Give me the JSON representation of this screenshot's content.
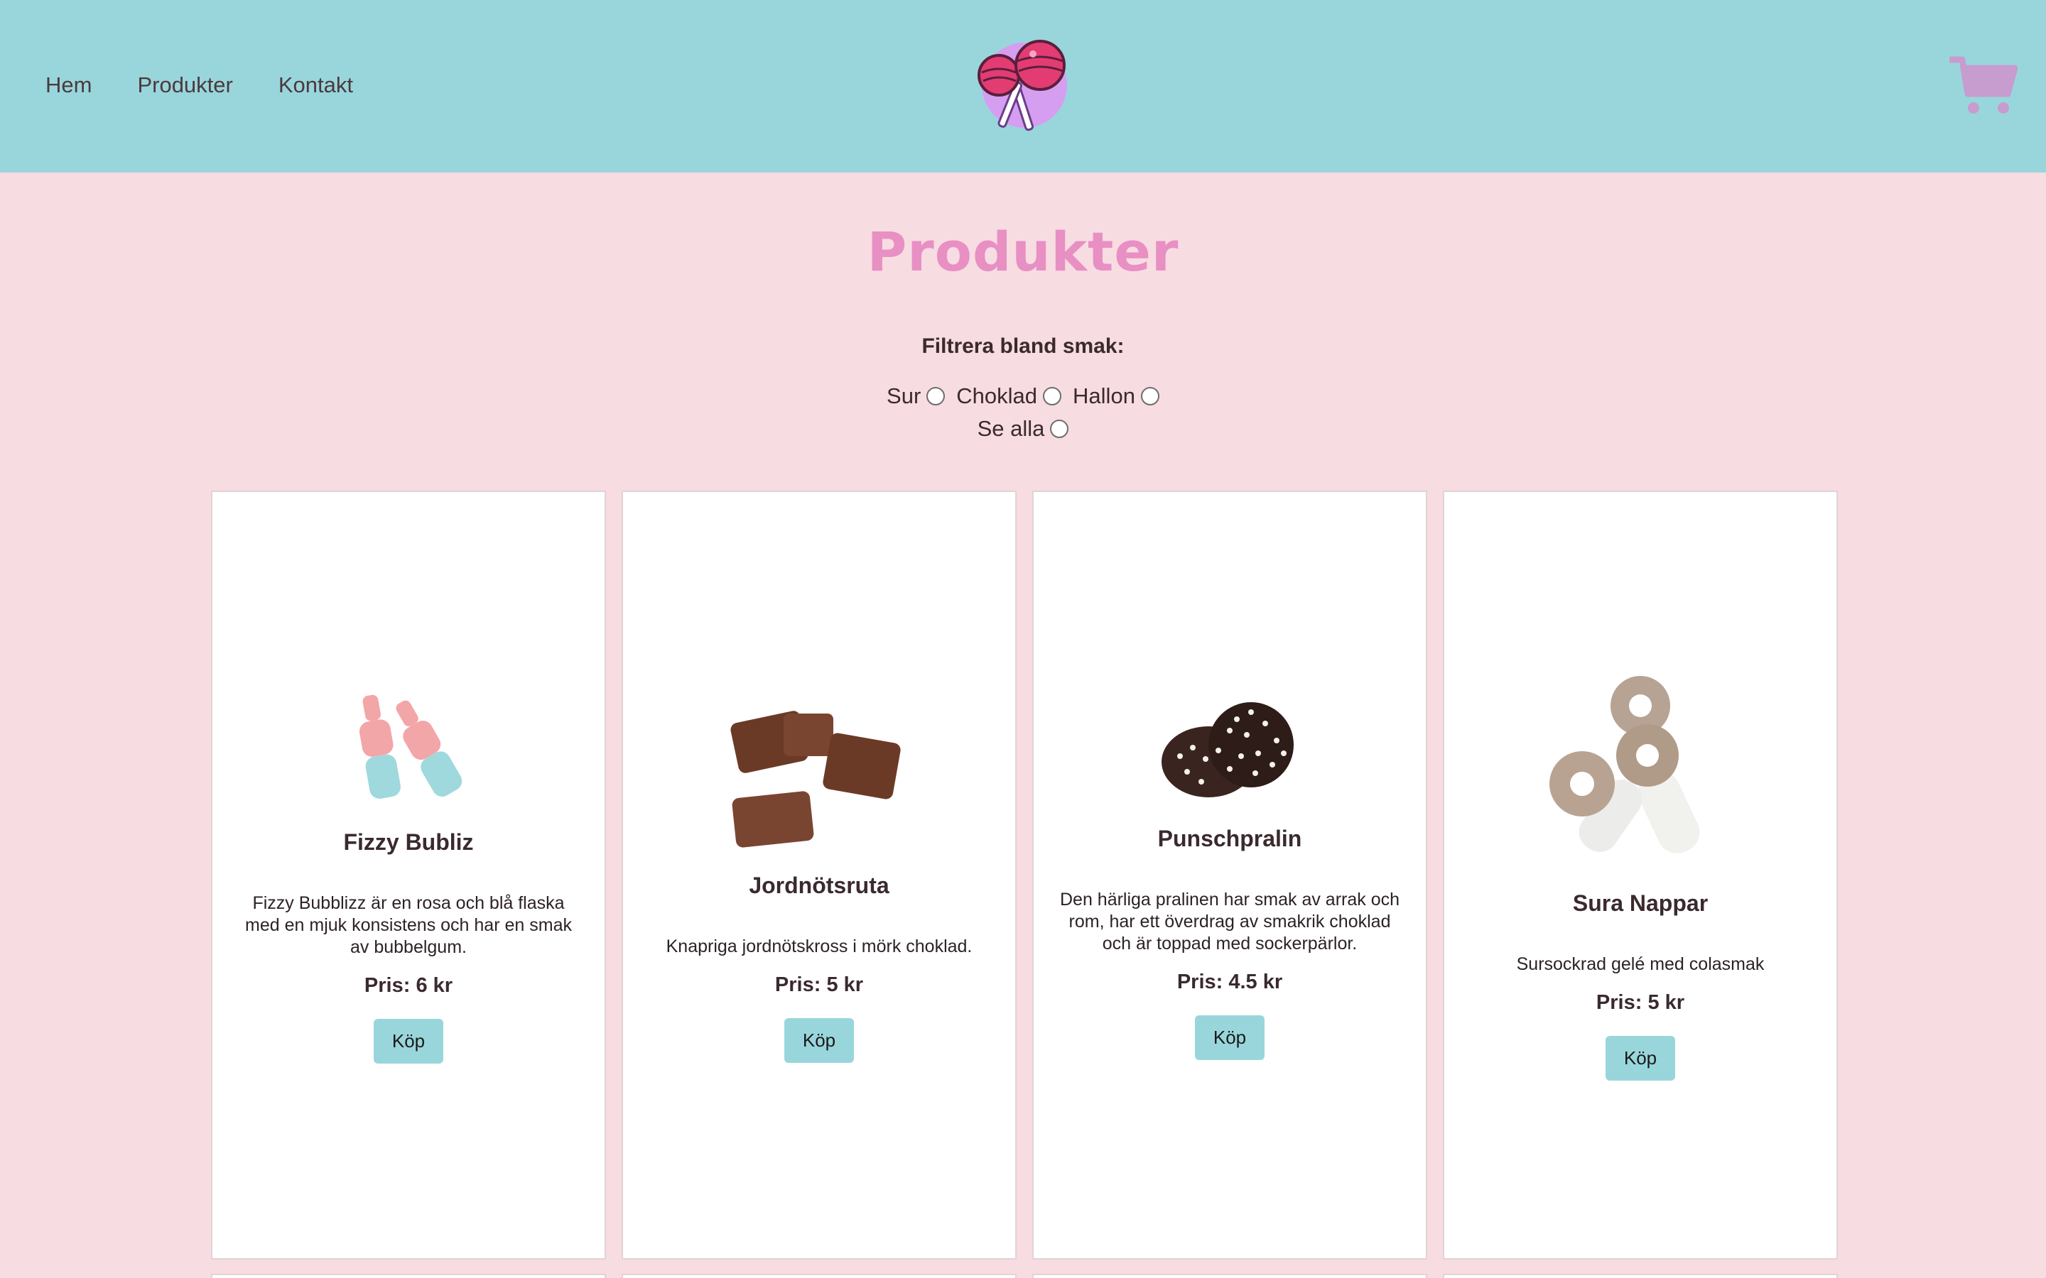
{
  "nav": {
    "items": [
      "Hem",
      "Produkter",
      "Kontakt"
    ]
  },
  "logo": {
    "icon": "lollipop-logo-icon"
  },
  "cart": {
    "icon": "shopping-cart-icon",
    "color": "#c79ccf"
  },
  "page": {
    "title": "Produkter",
    "title_color": "#e88fc4"
  },
  "filter": {
    "heading": "Filtrera bland smak:",
    "options": [
      "Sur",
      "Choklad",
      "Hallon",
      "Se alla"
    ]
  },
  "colors": {
    "header_bg": "#99d6dc",
    "page_bg": "#f7dce1",
    "button_bg": "#99d6dc"
  },
  "products": [
    {
      "name": "Fizzy Bubliz",
      "description": "Fizzy Bubblizz är en rosa och blå flaska med en mjuk konsistens och har en smak av bubbelgum.",
      "price": "Pris: 6 kr",
      "button": "Köp",
      "image": "fizzy-bottles-image"
    },
    {
      "name": "Jordnötsruta",
      "description": "Knapriga jordnötskross i mörk choklad.",
      "price": "Pris: 5 kr",
      "button": "Köp",
      "image": "chocolate-squares-image"
    },
    {
      "name": "Punschpralin",
      "description": "Den härliga pralinen har smak av arrak och rom, har ett överdrag av smakrik choklad och är toppad med sockerpärlor.",
      "price": "Pris: 4.5 kr",
      "button": "Köp",
      "image": "chocolate-praline-image"
    },
    {
      "name": "Sura Nappar",
      "description": "Sursockrad gelé med colasmak",
      "price": "Pris: 5 kr",
      "button": "Köp",
      "image": "sour-pacifier-candy-image"
    }
  ]
}
